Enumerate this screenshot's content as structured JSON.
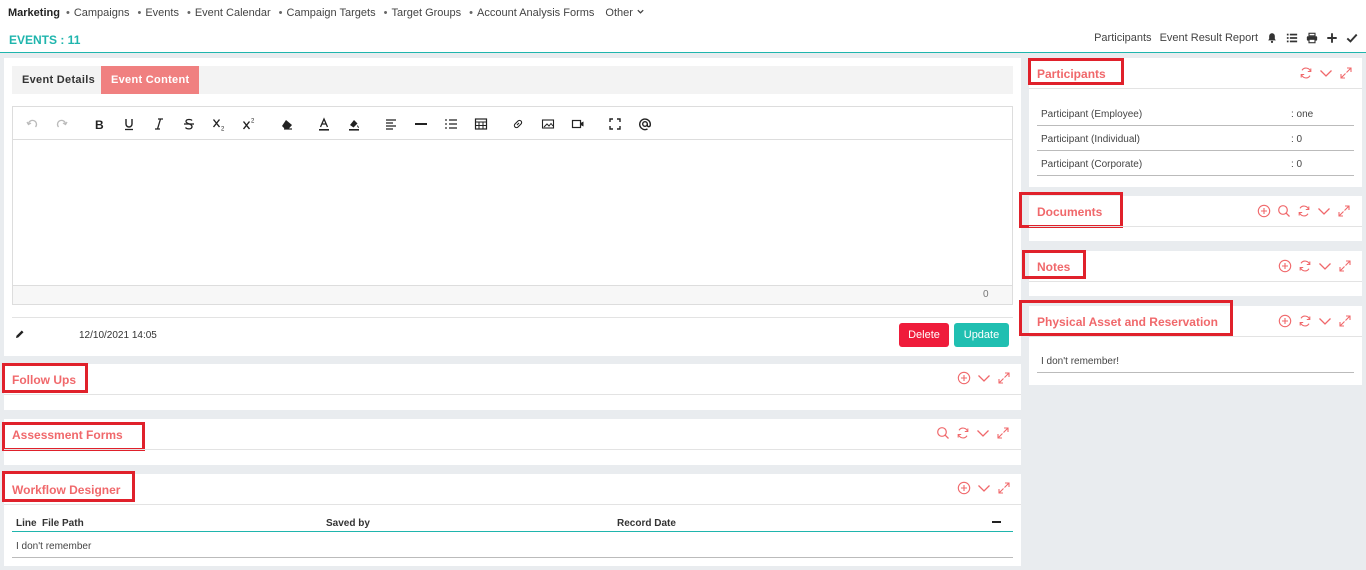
{
  "nav": {
    "brand": "Marketing",
    "items": [
      "Campaigns",
      "Events",
      "Event Calendar",
      "Campaign Targets",
      "Target Groups",
      "Account Analysis Forms"
    ],
    "other": "Other"
  },
  "header": {
    "title": "EVENTS : 11",
    "links": [
      "Participants",
      "Event Result Report"
    ],
    "icons": [
      "bell-icon",
      "list-icon",
      "print-icon",
      "plus-icon",
      "check-icon"
    ]
  },
  "event": {
    "tabs": [
      "Event Details",
      "Event Content"
    ],
    "active_tab": "Event Content",
    "char_count": "0",
    "timestamp": "12/10/2021 14:05",
    "delete_label": "Delete",
    "update_label": "Update",
    "toolbar": [
      "undo-icon",
      "redo-icon",
      "bold-icon",
      "underline-icon",
      "italic-icon",
      "strikethrough-icon",
      "subscript-icon",
      "superscript-icon",
      "eraser-icon",
      "font-color-icon",
      "highlight-icon",
      "align-icon",
      "horizontal-line-icon",
      "ordered-list-icon",
      "table-icon",
      "link-icon",
      "image-icon",
      "video-icon",
      "fullscreen-icon",
      "mention-icon"
    ]
  },
  "follow_ups": {
    "title": "Follow Ups"
  },
  "assessment": {
    "title": "Assessment Forms"
  },
  "workflow": {
    "title": "Workflow Designer",
    "columns": [
      "Line",
      "File Path",
      "Saved by",
      "Record Date"
    ],
    "empty": "I don't remember"
  },
  "participants": {
    "title": "Participants",
    "rows": [
      {
        "label": "Participant (Employee)",
        "value": ": one"
      },
      {
        "label": "Participant (Individual)",
        "value": ": 0"
      },
      {
        "label": "Participant (Corporate)",
        "value": ": 0"
      }
    ]
  },
  "documents": {
    "title": "Documents"
  },
  "notes": {
    "title": "Notes"
  },
  "physical": {
    "title": "Physical Asset and Reservation",
    "text": "I don't remember!"
  },
  "colors": {
    "accent": "#1fb5ad",
    "title_red": "#f0686b",
    "highlight": "#e0212b",
    "delete": "#ef1c3b",
    "update": "#20bfb1",
    "tab_active": "#f08080"
  }
}
